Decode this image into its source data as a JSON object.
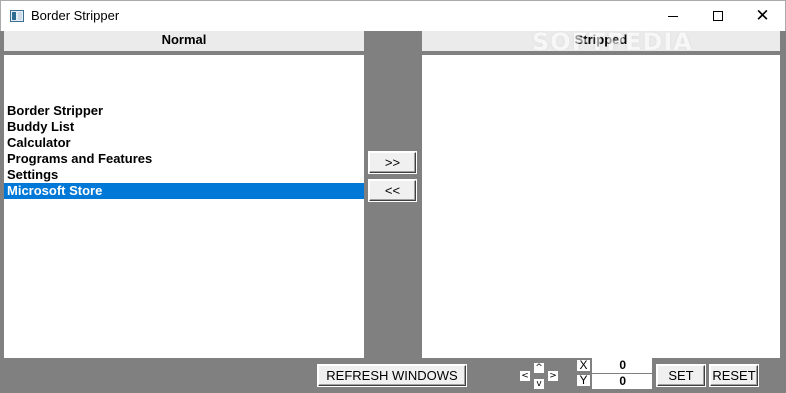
{
  "window": {
    "title": "Border Stripper",
    "minimize_label": "",
    "close_glyph": "✕"
  },
  "watermark": "SOFTPEDIA",
  "normal": {
    "header": "Normal",
    "items": [
      {
        "label": "Border Stripper",
        "selected": false
      },
      {
        "label": "Buddy List",
        "selected": false
      },
      {
        "label": "Calculator",
        "selected": false
      },
      {
        "label": "Programs and Features",
        "selected": false
      },
      {
        "label": "Settings",
        "selected": false
      },
      {
        "label": "Microsoft Store",
        "selected": true
      }
    ]
  },
  "stripped": {
    "header": "Stripped",
    "items": []
  },
  "buttons": {
    "move_right": ">>",
    "move_left": "<<",
    "refresh": "REFRESH WINDOWS",
    "set": "SET",
    "reset": "RESET"
  },
  "nudge": {
    "up": "^",
    "down": "v",
    "left": "<",
    "right": ">"
  },
  "position": {
    "x_label": "X",
    "y_label": "Y",
    "x_value": "0",
    "y_value": "0"
  },
  "colors": {
    "selection": "#0078d7",
    "background": "#808080"
  }
}
